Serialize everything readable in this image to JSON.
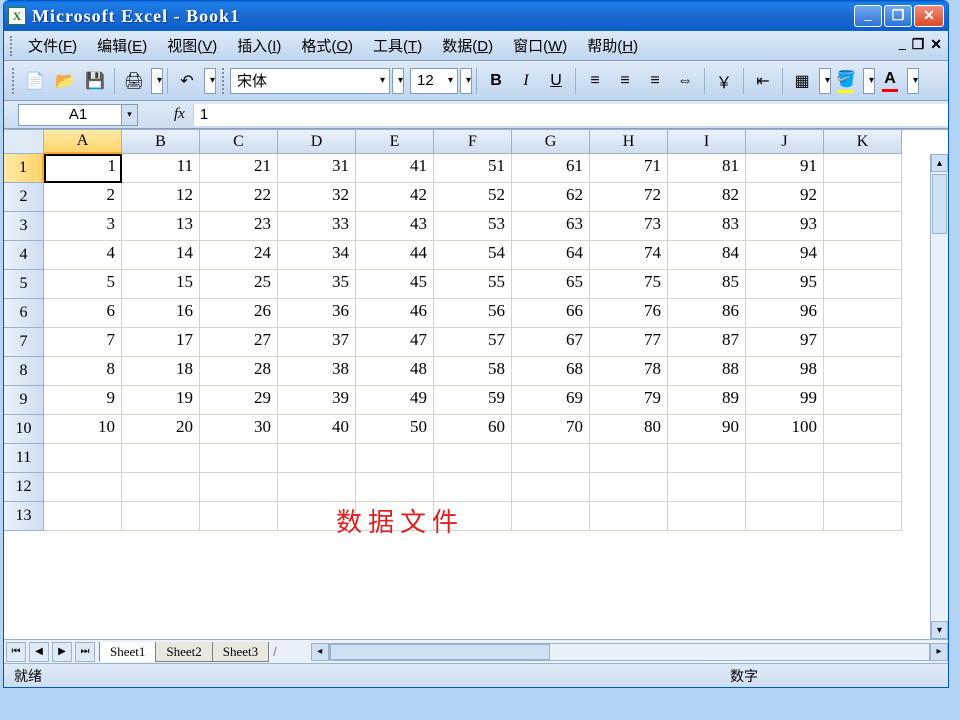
{
  "title": "Microsoft Excel - Book1",
  "menu": {
    "items": [
      {
        "label": "文件",
        "accel": "F"
      },
      {
        "label": "编辑",
        "accel": "E"
      },
      {
        "label": "视图",
        "accel": "V"
      },
      {
        "label": "插入",
        "accel": "I"
      },
      {
        "label": "格式",
        "accel": "O"
      },
      {
        "label": "工具",
        "accel": "T"
      },
      {
        "label": "数据",
        "accel": "D"
      },
      {
        "label": "窗口",
        "accel": "W"
      },
      {
        "label": "帮助",
        "accel": "H"
      }
    ]
  },
  "toolbar": {
    "font_name": "宋体",
    "font_size": "12"
  },
  "formula_bar": {
    "name_box": "A1",
    "fx_label": "fx",
    "formula": "1"
  },
  "grid": {
    "columns": [
      "A",
      "B",
      "C",
      "D",
      "E",
      "F",
      "G",
      "H",
      "I",
      "J",
      "K"
    ],
    "selected_col": "A",
    "selected_row": 1,
    "rows": [
      {
        "n": 1,
        "cells": [
          "1",
          "11",
          "21",
          "31",
          "41",
          "51",
          "61",
          "71",
          "81",
          "91",
          ""
        ]
      },
      {
        "n": 2,
        "cells": [
          "2",
          "12",
          "22",
          "32",
          "42",
          "52",
          "62",
          "72",
          "82",
          "92",
          ""
        ]
      },
      {
        "n": 3,
        "cells": [
          "3",
          "13",
          "23",
          "33",
          "43",
          "53",
          "63",
          "73",
          "83",
          "93",
          ""
        ]
      },
      {
        "n": 4,
        "cells": [
          "4",
          "14",
          "24",
          "34",
          "44",
          "54",
          "64",
          "74",
          "84",
          "94",
          ""
        ]
      },
      {
        "n": 5,
        "cells": [
          "5",
          "15",
          "25",
          "35",
          "45",
          "55",
          "65",
          "75",
          "85",
          "95",
          ""
        ]
      },
      {
        "n": 6,
        "cells": [
          "6",
          "16",
          "26",
          "36",
          "46",
          "56",
          "66",
          "76",
          "86",
          "96",
          ""
        ]
      },
      {
        "n": 7,
        "cells": [
          "7",
          "17",
          "27",
          "37",
          "47",
          "57",
          "67",
          "77",
          "87",
          "97",
          ""
        ]
      },
      {
        "n": 8,
        "cells": [
          "8",
          "18",
          "28",
          "38",
          "48",
          "58",
          "68",
          "78",
          "88",
          "98",
          ""
        ]
      },
      {
        "n": 9,
        "cells": [
          "9",
          "19",
          "29",
          "39",
          "49",
          "59",
          "69",
          "79",
          "89",
          "99",
          ""
        ]
      },
      {
        "n": 10,
        "cells": [
          "10",
          "20",
          "30",
          "40",
          "50",
          "60",
          "70",
          "80",
          "90",
          "100",
          ""
        ]
      },
      {
        "n": 11,
        "cells": [
          "",
          "",
          "",
          "",
          "",
          "",
          "",
          "",
          "",
          "",
          ""
        ]
      },
      {
        "n": 12,
        "cells": [
          "",
          "",
          "",
          "",
          "",
          "",
          "",
          "",
          "",
          "",
          ""
        ]
      },
      {
        "n": 13,
        "cells": [
          "",
          "",
          "",
          "",
          "",
          "",
          "",
          "",
          "",
          "",
          ""
        ]
      }
    ],
    "overlay_annotation": "数据文件"
  },
  "sheet_tabs": {
    "tabs": [
      "Sheet1",
      "Sheet2",
      "Sheet3"
    ],
    "active": "Sheet1"
  },
  "status_bar": {
    "left": "就绪",
    "right": "数字"
  }
}
